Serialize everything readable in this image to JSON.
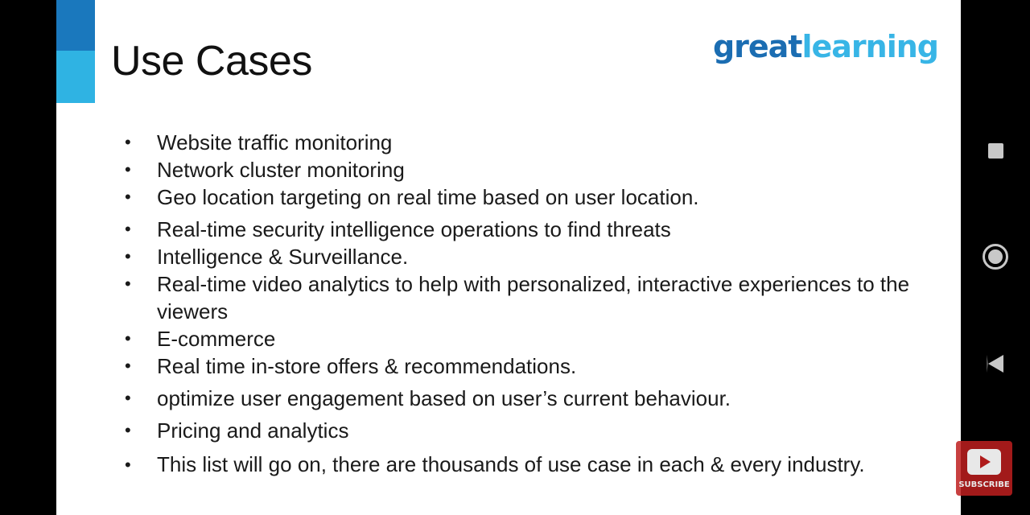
{
  "slide": {
    "title": "Use Cases",
    "logo": {
      "part1": "great",
      "part2": "learning",
      "colors": {
        "part1": "#1b6db2",
        "part2": "#38b5e6"
      }
    },
    "accent_colors": {
      "top": "#1a78bd",
      "bottom": "#2fb3e3"
    },
    "bullet_glyph": "•",
    "bullets": [
      {
        "text": "Website traffic monitoring"
      },
      {
        "text": "Network cluster monitoring"
      },
      {
        "text": "Geo location targeting on real time based on user location."
      },
      {
        "text": "Real-time security intelligence operations to find threats"
      },
      {
        "text": "Intelligence & Surveillance."
      },
      {
        "text": "Real-time video analytics to help with personalized, interactive experiences to the viewers"
      },
      {
        "text": "E-commerce"
      },
      {
        "text": "Real time in-store offers & recommendations."
      },
      {
        "text": "optimize user engagement based on user’s current behaviour."
      },
      {
        "text": "Pricing and analytics"
      },
      {
        "text": "This list will go on, there are thousands of use case in each & every industry."
      }
    ]
  },
  "navbar": {
    "recents_icon": "square-recents-icon",
    "home_icon": "circle-home-icon",
    "back_icon": "triangle-back-icon"
  },
  "subscribe": {
    "label": "SUBSCRIBE",
    "icon": "youtube-play-icon",
    "color": "#be1e1e"
  }
}
